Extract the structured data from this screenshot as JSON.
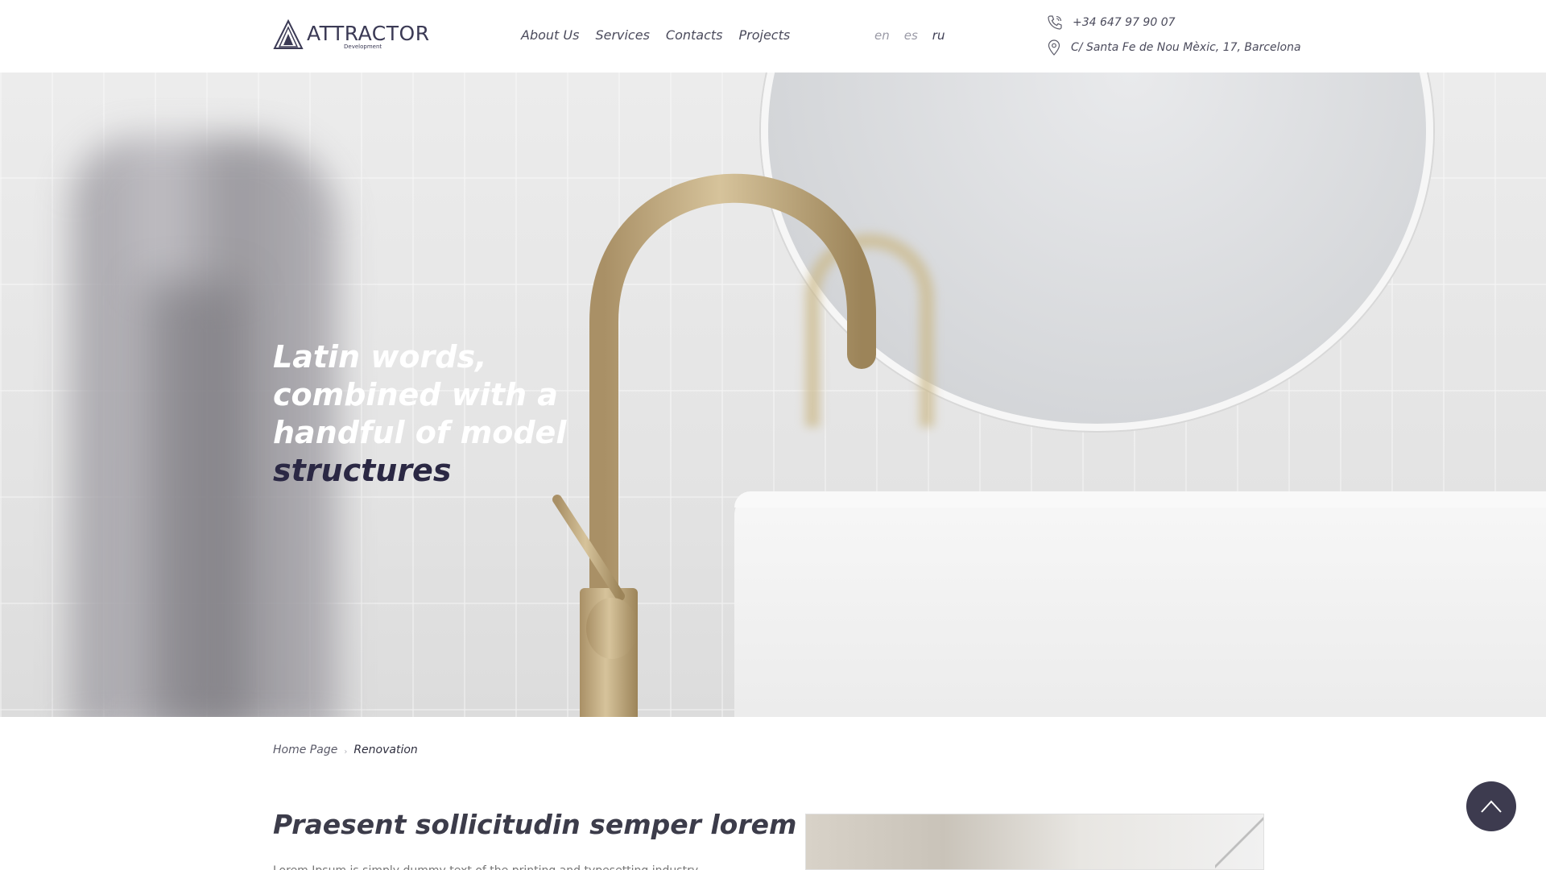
{
  "header": {
    "logo_text": "ATTRACTOR",
    "logo_sub": "Development",
    "nav": [
      "About Us",
      "Services",
      "Contacts",
      "Projects"
    ],
    "languages": [
      {
        "code": "en",
        "active": false
      },
      {
        "code": "es",
        "active": false
      },
      {
        "code": "ru",
        "active": true
      }
    ],
    "phone": "+34 647 97 90 07",
    "address": "C/ Santa Fe de Nou Mèxic, 17, Barcelona"
  },
  "hero": {
    "title_part1": "Latin words, combined with a handful of model ",
    "title_highlight": "structures"
  },
  "breadcrumb": {
    "home": "Home Page",
    "current": "Renovation"
  },
  "content": {
    "title": "Praesent sollicitudin semper lorem",
    "text": "Lorem Ipsum is simply dummy text of the printing and typesetting industry. Lorem"
  },
  "colors": {
    "accent": "#2b2844",
    "to_top_bg": "#3d3b4f"
  },
  "icons": {
    "phone": "phone-icon",
    "location": "location-pin-icon",
    "to_top": "chevron-up-icon"
  }
}
